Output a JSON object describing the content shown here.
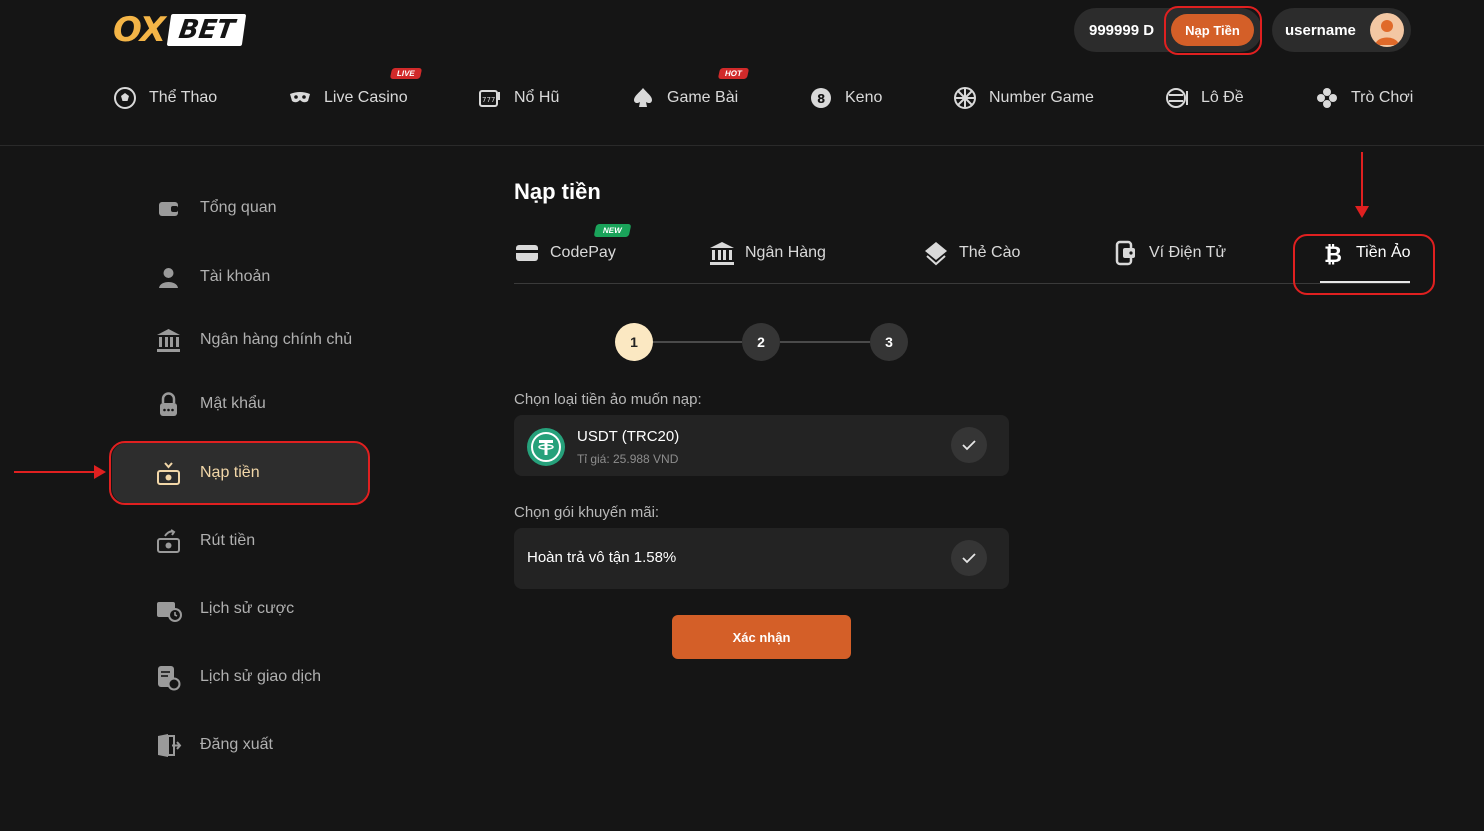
{
  "header": {
    "logo_ox": "OX",
    "logo_bet": "BET",
    "balance": "999999 D",
    "deposit_button": "Nạp Tiền",
    "username": "username"
  },
  "nav": {
    "items": [
      {
        "label": "Thể Thao",
        "icon": "soccer-ball-icon"
      },
      {
        "label": "Live Casino",
        "icon": "mask-icon",
        "badge": "LIVE"
      },
      {
        "label": "Nổ Hũ",
        "icon": "slot-machine-icon"
      },
      {
        "label": "Game Bài",
        "icon": "spade-icon",
        "badge": "HOT"
      },
      {
        "label": "Keno",
        "icon": "ball-8-icon"
      },
      {
        "label": "Number Game",
        "icon": "wheel-icon"
      },
      {
        "label": "Lô Đề",
        "icon": "lottery-ball-icon"
      },
      {
        "label": "Trò Chơi",
        "icon": "clover-icon"
      }
    ]
  },
  "sidebar": {
    "items": [
      {
        "label": "Tổng quan",
        "icon": "wallet-icon"
      },
      {
        "label": "Tài khoản",
        "icon": "user-icon"
      },
      {
        "label": "Ngân hàng chính chủ",
        "icon": "bank-icon"
      },
      {
        "label": "Mật khẩu",
        "icon": "lock-icon"
      },
      {
        "label": "Nạp tiền",
        "icon": "deposit-money-icon",
        "active": true
      },
      {
        "label": "Rút tiền",
        "icon": "withdraw-money-icon"
      },
      {
        "label": "Lịch sử cược",
        "icon": "ticket-history-icon"
      },
      {
        "label": "Lịch sử giao dịch",
        "icon": "transaction-history-icon"
      },
      {
        "label": "Đăng xuất",
        "icon": "logout-icon"
      }
    ]
  },
  "main": {
    "title": "Nạp tiền",
    "tabs": [
      {
        "label": "CodePay",
        "icon": "card-icon",
        "badge": "NEW"
      },
      {
        "label": "Ngân Hàng",
        "icon": "bank-icon"
      },
      {
        "label": "Thẻ Cào",
        "icon": "layers-icon"
      },
      {
        "label": "Ví Điện Tử",
        "icon": "e-wallet-icon"
      },
      {
        "label": "Tiền Ảo",
        "icon": "bitcoin-icon",
        "active": true
      }
    ],
    "steps": [
      "1",
      "2",
      "3"
    ],
    "current_step": 1,
    "crypto_label": "Chọn loại tiền ảo muốn nạp:",
    "crypto_option": {
      "title": "USDT (TRC20)",
      "rate": "Tỉ giá: 25.988 VND"
    },
    "promo_label": "Chọn gói khuyến mãi:",
    "promo_option": "Hoàn trả vô tận 1.58%",
    "confirm_button": "Xác nhận"
  },
  "colors": {
    "accent": "#d45f28",
    "background": "#151515",
    "annotation": "#e02020",
    "logo_yellow": "#f4b547",
    "tether_green": "#26a17b"
  }
}
